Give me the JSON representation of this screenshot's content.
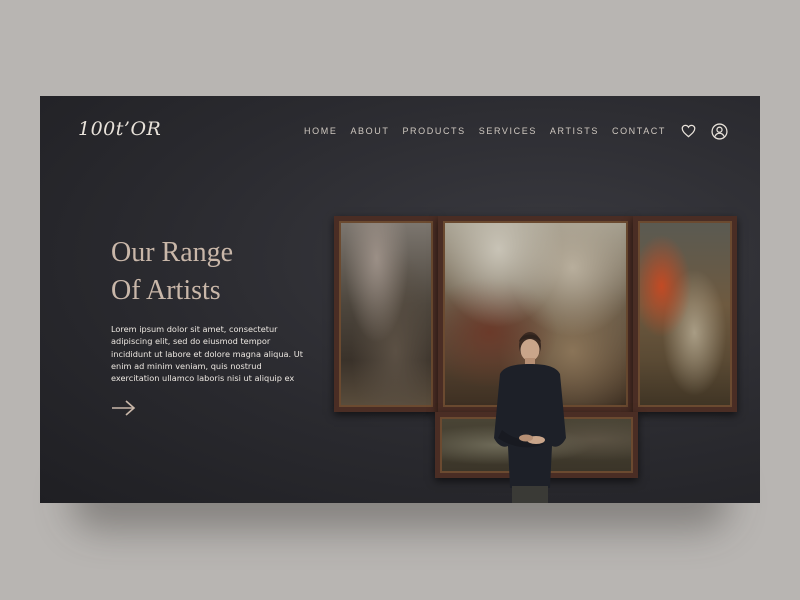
{
  "brand": {
    "logo_text": "100t’OR"
  },
  "nav": {
    "items": [
      {
        "label": "HOME"
      },
      {
        "label": "ABOUT"
      },
      {
        "label": "PRODUCTS"
      },
      {
        "label": "SERVICES"
      },
      {
        "label": "ARTISTS"
      },
      {
        "label": "CONTACT"
      }
    ],
    "icons": [
      "heart-icon",
      "user-icon"
    ]
  },
  "hero": {
    "title_line1": "Our Range",
    "title_line2": "Of Artists",
    "body": "Lorem ipsum dolor sit amet, consectetur adipiscing elit, sed do eiusmod tempor incididunt ut labore et dolore magna aliqua. Ut enim ad minim veniam, quis nostrud exercitation ullamco laboris nisi ut aliquip ex",
    "cta_icon": "arrow-right-icon"
  },
  "colors": {
    "background": "#2a2a2f",
    "accent_title": "#c9b7a9",
    "text_light": "#ece7e1",
    "page_backdrop": "#b8b5b2"
  }
}
